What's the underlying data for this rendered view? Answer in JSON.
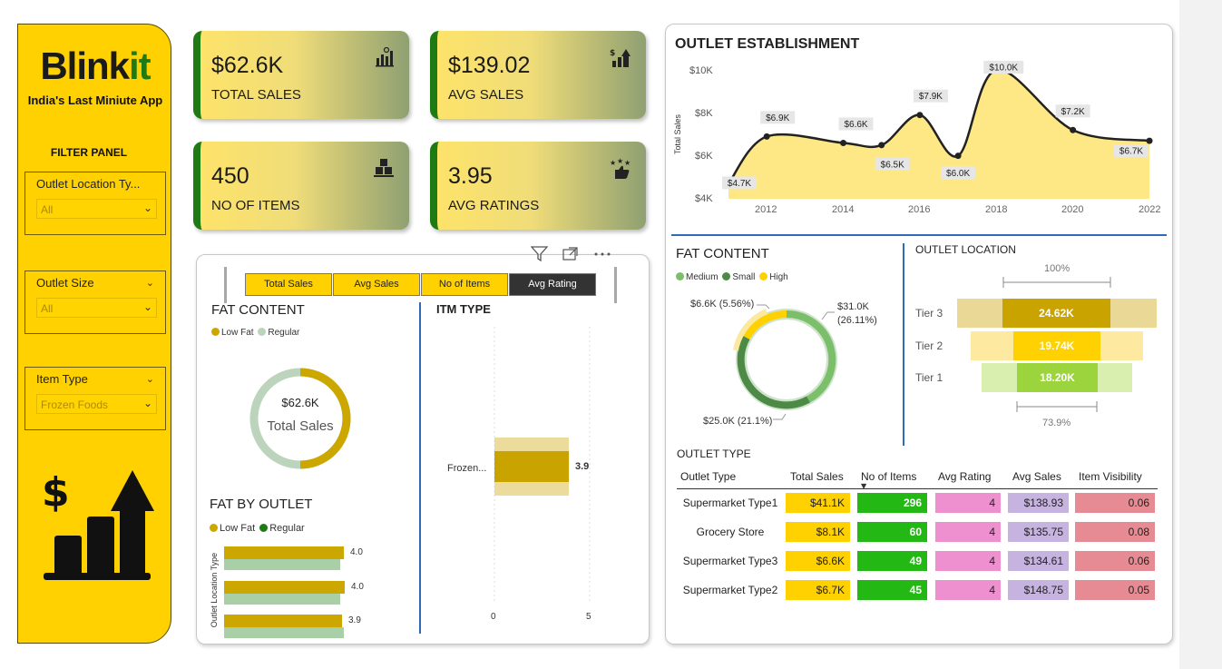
{
  "brand": {
    "name_part1": "Blink",
    "name_part2": "it",
    "tagline": "India's Last Miniute App"
  },
  "filters": {
    "title": "FILTER PANEL",
    "items": [
      {
        "label": "Outlet Location Ty...",
        "value": "All"
      },
      {
        "label": "Outlet Size",
        "value": "All"
      },
      {
        "label": "Item Type",
        "value": "Frozen Foods"
      }
    ]
  },
  "kpis": [
    {
      "value": "$62.6K",
      "caption": "TOTAL SALES",
      "icon": "sales-chart-icon"
    },
    {
      "value": "$139.02",
      "caption": "AVG SALES",
      "icon": "bar-growth-icon"
    },
    {
      "value": "450",
      "caption": "NO OF ITEMS",
      "icon": "boxes-icon"
    },
    {
      "value": "3.95",
      "caption": "AVG RATINGS",
      "icon": "rating-stars-icon"
    }
  ],
  "toggle": {
    "buttons": [
      "Total Sales",
      "Avg Sales",
      "No of Items",
      "Avg Rating"
    ],
    "active": "Avg Rating"
  },
  "colors": {
    "brand_yellow": "#ffd100",
    "brand_green": "#1e7b14",
    "low_fat": "#cca700",
    "regular": "#bcd4bc",
    "tier3": "#c9a400",
    "tier2": "#ffd100",
    "tier1": "#9bd43d"
  },
  "fat_content_left": {
    "title": "FAT CONTENT",
    "legend": [
      "Low Fat",
      "Regular"
    ],
    "center_value": "$62.6K",
    "center_label": "Total Sales"
  },
  "itm_type": {
    "title": "ITM TYPE",
    "bar_label": "Frozen...",
    "bar_value": "3.9",
    "axis_ticks": [
      "0",
      "5"
    ]
  },
  "fat_by_outlet": {
    "title": "FAT BY OUTLET",
    "legend": [
      "Low Fat",
      "Regular"
    ],
    "axis_label": "Outlet Location Type",
    "values": [
      "4.0",
      "4.0",
      "3.9"
    ]
  },
  "outlet_establishment": {
    "title": "OUTLET ESTABLISHMENT",
    "ylabel": "Total Sales",
    "yticks": [
      "$10K",
      "$8K",
      "$6K",
      "$4K"
    ],
    "xticks": [
      "2012",
      "2014",
      "2016",
      "2018",
      "2020",
      "2022"
    ]
  },
  "chart_data": {
    "type": "area",
    "x": [
      2011,
      2012,
      2014,
      2015,
      2016,
      2017,
      2018,
      2020,
      2022
    ],
    "values": [
      4.7,
      6.9,
      6.6,
      6.5,
      7.9,
      6.0,
      10.0,
      7.2,
      6.7
    ],
    "labels": [
      "$4.7K",
      "$6.9K",
      "$6.6K",
      "$6.5K",
      "$7.9K",
      "$6.0K",
      "$10.0K",
      "$7.2K",
      "$6.7K"
    ],
    "title": "OUTLET ESTABLISHMENT",
    "xlabel": "",
    "ylabel": "Total Sales",
    "ylim": [
      4,
      10
    ]
  },
  "fat_content_right": {
    "title": "FAT CONTENT",
    "legend": [
      "Medium",
      "Small",
      "High"
    ],
    "labels": [
      "$6.6K (5.56%)",
      "$31.0K",
      "(26.11%)",
      "$25.0K (21.1%)"
    ]
  },
  "outlet_location": {
    "title": "OUTLET LOCATION",
    "top_pct": "100%",
    "bottom_pct": "73.9%",
    "tiers": [
      {
        "name": "Tier 3",
        "value": "24.62K"
      },
      {
        "name": "Tier 2",
        "value": "19.74K"
      },
      {
        "name": "Tier 1",
        "value": "18.20K"
      }
    ]
  },
  "outlet_type": {
    "title": "OUTLET TYPE",
    "columns": [
      "Outlet Type",
      "Total Sales",
      "No of Items",
      "Avg Rating",
      "Avg Sales",
      "Item Visibility"
    ],
    "rows": [
      [
        "Supermarket Type1",
        "$41.1K",
        "296",
        "4",
        "$138.93",
        "0.06"
      ],
      [
        "Grocery Store",
        "$8.1K",
        "60",
        "4",
        "$135.75",
        "0.08"
      ],
      [
        "Supermarket Type3",
        "$6.6K",
        "49",
        "4",
        "$134.61",
        "0.06"
      ],
      [
        "Supermarket Type2",
        "$6.7K",
        "45",
        "4",
        "$148.75",
        "0.05"
      ]
    ]
  }
}
